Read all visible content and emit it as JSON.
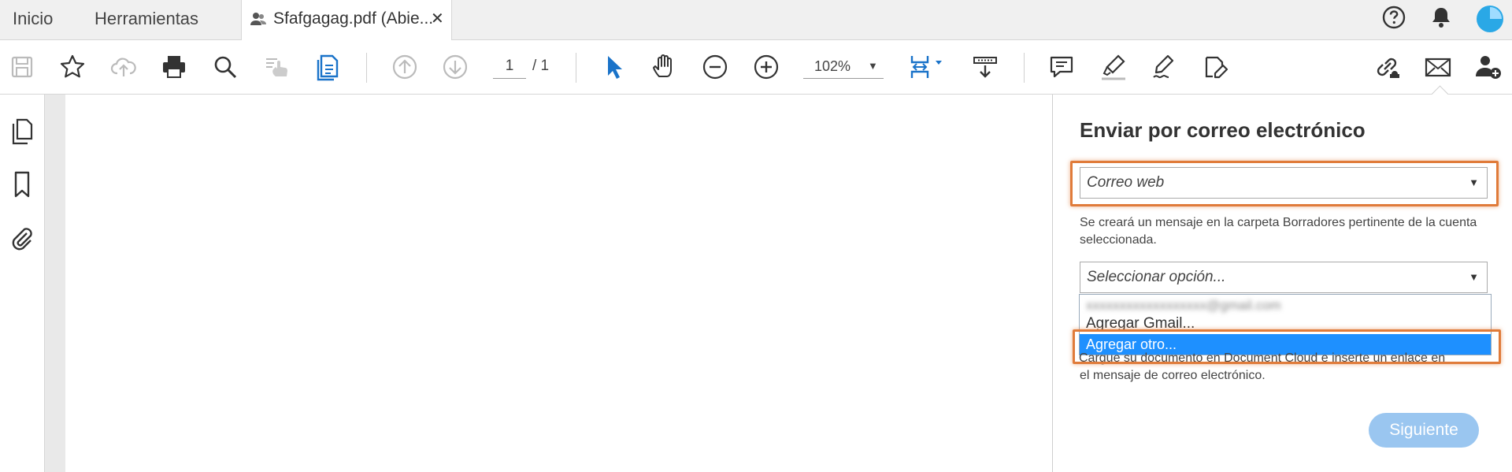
{
  "tabs": {
    "home": "Inicio",
    "tools": "Herramientas",
    "document": "Sfafgagag.pdf (Abie...",
    "close": "✕"
  },
  "toolbar": {
    "page_current": "1",
    "page_total": "/ 1",
    "zoom": "102%"
  },
  "icons": {
    "tabs_right": [
      "help-icon",
      "bell-icon",
      "profile-icon"
    ],
    "toolbar": [
      "save-icon",
      "star-icon",
      "cloud-upload-icon",
      "print-icon",
      "search-icon",
      "hand-sign-icon",
      "document-icon",
      "arrow-up-icon",
      "arrow-down-icon",
      "pointer-icon",
      "hand-icon",
      "zoom-out-icon",
      "zoom-in-icon",
      "fit-page-icon",
      "scroll-icon",
      "comment-icon",
      "highlighter-icon",
      "sign-icon",
      "edit-icon",
      "link-icon",
      "mail-icon",
      "add-user-icon"
    ],
    "leftrail": [
      "pages-icon",
      "bookmark-icon",
      "attachment-icon"
    ]
  },
  "panel": {
    "title": "Enviar por correo electrónico",
    "mail_type": "Correo web",
    "desc1": "Se creará un mensaje en la carpeta Borradores pertinente de la cuenta seleccionada.",
    "account_placeholder": "Seleccionar opción...",
    "options": [
      "Agregar Gmail...",
      "Agregar otro..."
    ],
    "desc2_line1": "Cargue su documento en Document Cloud e inserte un enlace en",
    "desc2_line2": "el mensaje de correo electrónico.",
    "next_button": "Siguiente"
  },
  "colors": {
    "accent": "#1e90ff",
    "highlight": "#e07b3a",
    "button": "#9ac6f0",
    "icon_blue": "#1a73c9"
  }
}
